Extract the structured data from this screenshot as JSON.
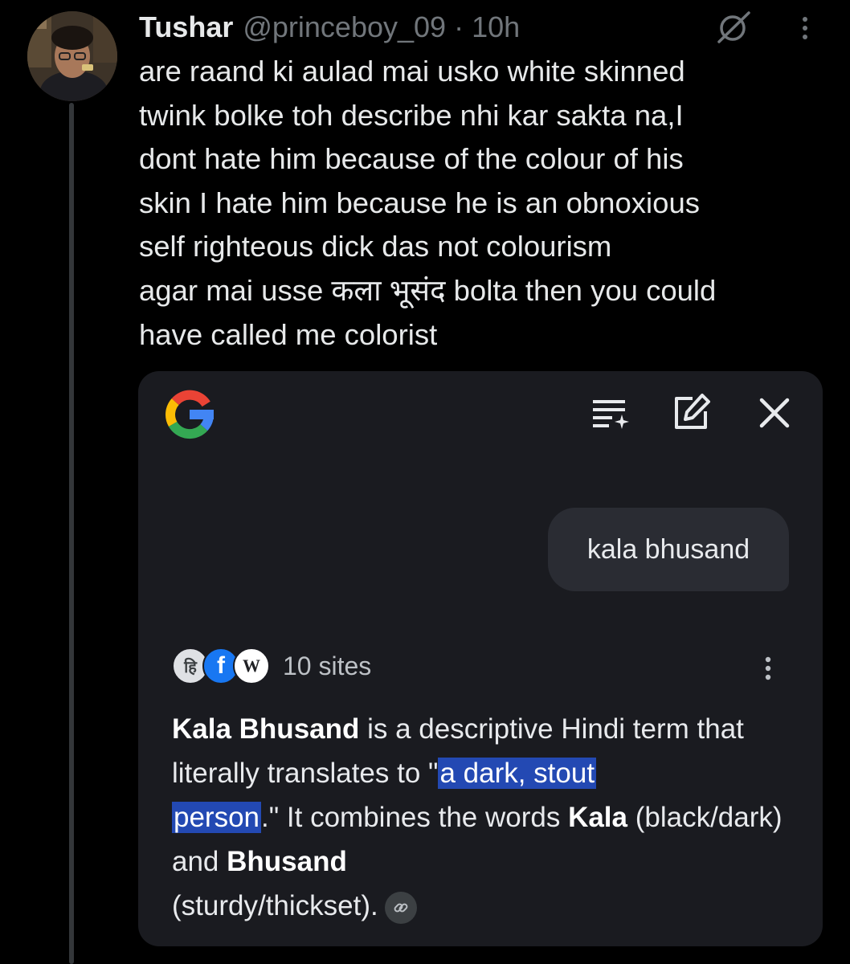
{
  "post": {
    "display_name": "Tushar",
    "handle": "@princeboy_09",
    "separator": "·",
    "time": "10h",
    "text_lines": [
      "are raand ki aulad mai usko white skinned",
      "twink bolke toh describe nhi kar sakta na,I",
      "dont hate him because of the colour of his",
      "skin I hate him because he is an obnoxious",
      "self righteous dick das not colourism",
      "agar mai usse कला भूसंद bolta then you could",
      "have called me colorist"
    ]
  },
  "icons": {
    "header": [
      "avatar",
      "grok-icon",
      "more-icon"
    ],
    "card": [
      "google-g-icon",
      "filter-list-icon",
      "edit-icon",
      "close-icon",
      "more-vertical-icon",
      "link-icon"
    ]
  },
  "google_card": {
    "query": "kala bhusand",
    "sources": {
      "favicons": [
        "हि",
        "f",
        "W"
      ],
      "count_label": "10 sites"
    },
    "answer": {
      "term": "Kala Bhusand",
      "seg1": " is a descriptive Hindi term that literally translates to \"",
      "highlight_a": "a dark, stout",
      "highlight_b": "person",
      "seg2": ".\" It combines the words ",
      "word1": "Kala",
      "seg3": " (black/dark) and ",
      "word2": "Bhusand",
      "seg4": " (sturdy/thickset)."
    }
  },
  "colors": {
    "background": "#000000",
    "text": "#e7e9ea",
    "muted": "#71767b",
    "card": "#1a1b20",
    "bubble": "#2a2c33",
    "highlight": "#2349b3",
    "google_blue": "#4285f4",
    "google_red": "#ea4335",
    "google_yellow": "#fbbc05",
    "google_green": "#34a853"
  }
}
